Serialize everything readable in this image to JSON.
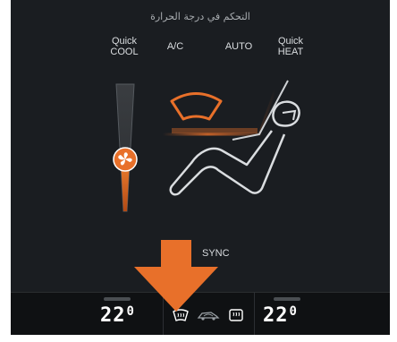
{
  "header": {
    "title": "التحكم في درجة الحرارة"
  },
  "modes": {
    "quick_cool": "Quick\nCOOL",
    "ac": "A/C",
    "auto": "AUTO",
    "quick_heat": "Quick\nHEAT"
  },
  "sync_label": "SYNC",
  "temperature": {
    "left": {
      "whole": "22",
      "decimal": "0"
    },
    "right": {
      "whole": "22",
      "decimal": "0"
    }
  },
  "icons": {
    "front_defrost": "windshield-defrost-icon",
    "recirculation": "recirculation-icon",
    "rear_defrost": "rear-defrost-icon",
    "fan": "fan-icon",
    "seat": "seat-icon",
    "arrow": "pointer-arrow"
  },
  "colors": {
    "accent": "#e8702a",
    "background": "#1a1d21",
    "text": "#dadde0"
  },
  "fan_level": 0.45
}
